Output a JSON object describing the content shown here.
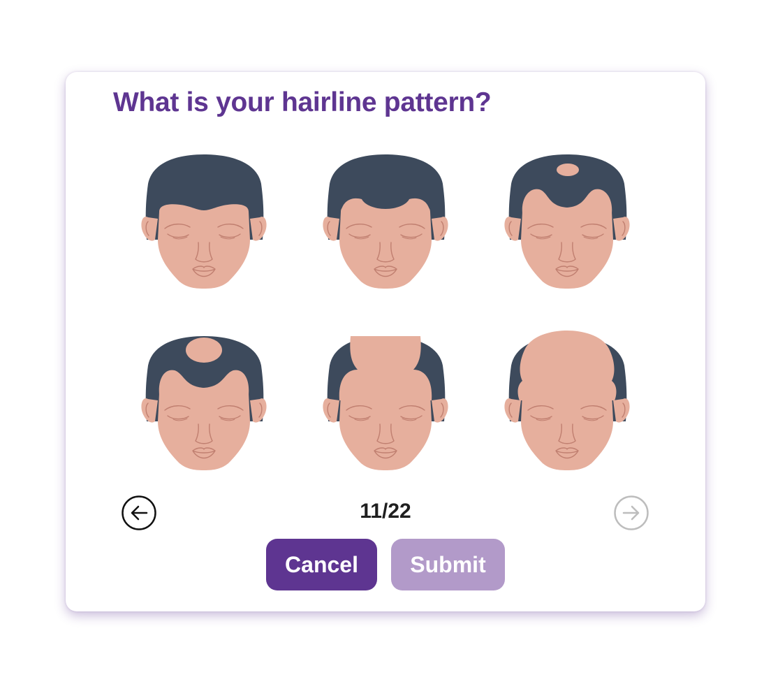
{
  "dialog": {
    "title": "What is your hairline pattern?"
  },
  "options": [
    {
      "id": "pattern-1",
      "stage": 1
    },
    {
      "id": "pattern-2",
      "stage": 2
    },
    {
      "id": "pattern-3",
      "stage": 3
    },
    {
      "id": "pattern-4",
      "stage": 4
    },
    {
      "id": "pattern-5",
      "stage": 5
    },
    {
      "id": "pattern-6",
      "stage": 6
    }
  ],
  "pagination": {
    "counter": "11/22",
    "prev_icon": "arrow-left-circle-icon",
    "next_icon": "arrow-right-circle-icon",
    "next_enabled": false
  },
  "actions": {
    "cancel_label": "Cancel",
    "submit_label": "Submit",
    "submit_enabled": false
  },
  "colors": {
    "accent": "#5e3591",
    "accent_disabled": "#b29ac9",
    "hair": "#3d4a5c",
    "skin": "#e6af9d",
    "skin_line": "#c07f70",
    "arrow_active": "#111111",
    "arrow_disabled": "#bdbdbd"
  }
}
